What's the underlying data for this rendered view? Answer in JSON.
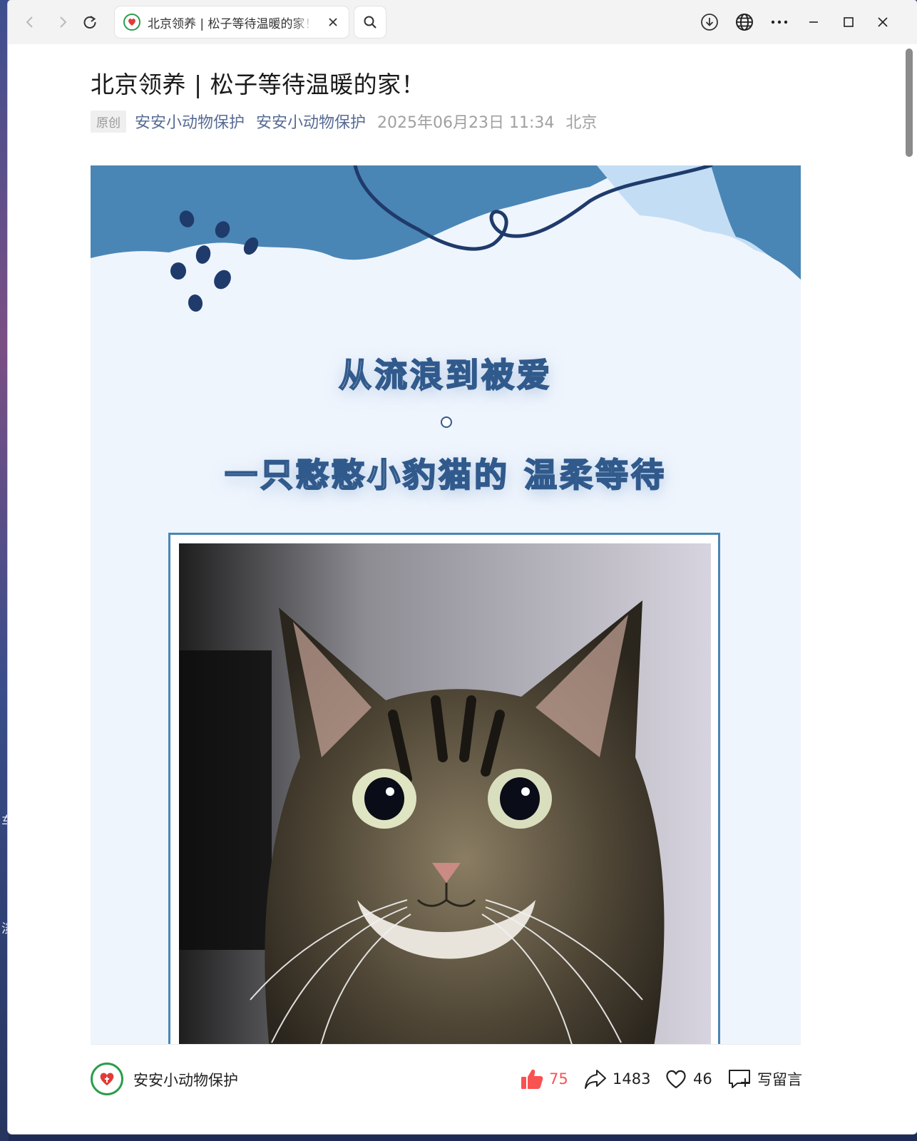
{
  "window": {
    "tab_title": "北京领养 | 松子等待温暖的家！",
    "desktop_glyphs": [
      "车",
      "淡"
    ]
  },
  "article": {
    "title": "北京领养 | 松子等待温暖的家！",
    "original_tag": "原创",
    "author_1": "安安小动物保护",
    "author_2": "安安小动物保护",
    "date": "2025年06月23日 11:34",
    "location": "北京"
  },
  "banner": {
    "line_1": "从流浪到被爱",
    "line_2": "一只憨憨小豹猫的 温柔等待"
  },
  "bottom_bar": {
    "account_name": "安安小动物保护",
    "like_count": "75",
    "share_count": "1483",
    "favorite_count": "46",
    "comment_label": "写留言"
  },
  "colors": {
    "link_blue": "#576b95",
    "like_red": "#fa5151",
    "banner_blue": "#4a86b5",
    "navy": "#1f3b6b"
  },
  "icons": [
    "back-icon",
    "forward-icon",
    "refresh-icon",
    "close-icon",
    "search-icon",
    "download-icon",
    "globe-icon",
    "more-icon",
    "minimize-icon",
    "maximize-icon",
    "window-close-icon",
    "thumbs-up-icon",
    "share-icon",
    "heart-icon",
    "comment-icon"
  ]
}
